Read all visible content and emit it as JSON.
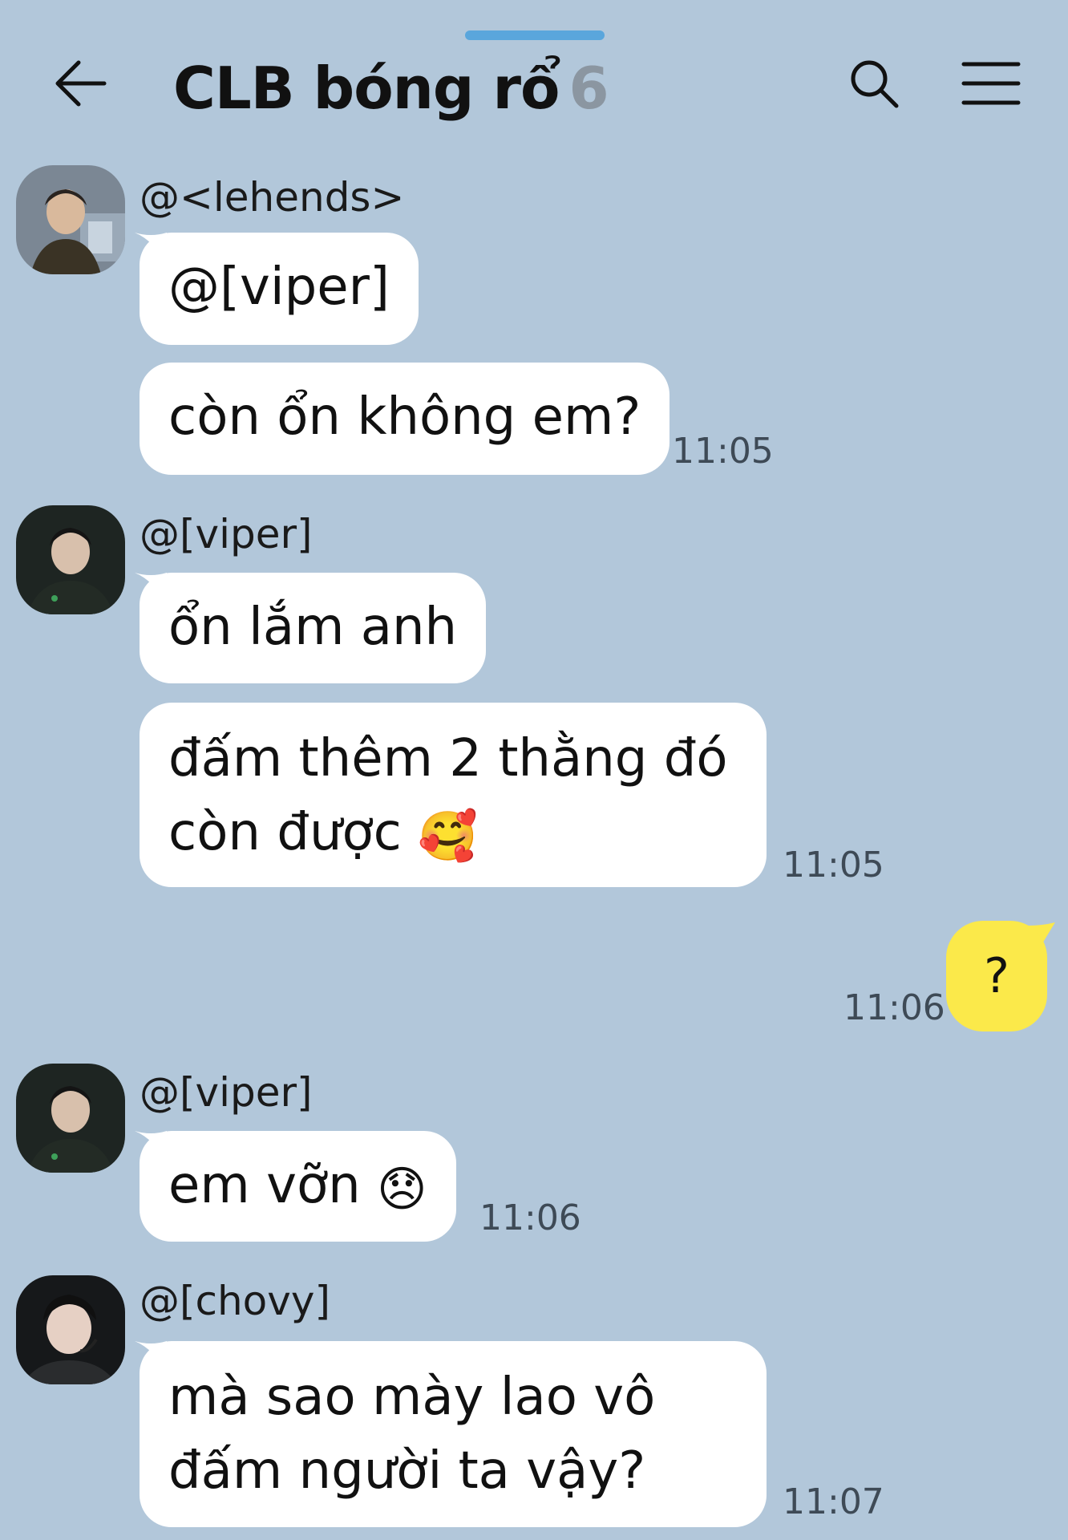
{
  "header": {
    "title": "CLB bóng rổ",
    "member_count": "6"
  },
  "icons": {
    "back": "arrow-left-icon",
    "search": "search-icon",
    "menu": "hamburger-menu-icon"
  },
  "colors": {
    "background": "#b2c7da",
    "bubble_other": "#ffffff",
    "bubble_me": "#fbe94a",
    "handle": "#5aa6dc"
  },
  "messages": [
    {
      "sender": "@<lehends>",
      "bubbles": [
        "@[viper]",
        "còn ổn không em?"
      ],
      "time": "11:05"
    },
    {
      "sender": "@[viper]",
      "bubbles": [
        "ổn lắm anh",
        "đấm thêm 2 thằng đó",
        "còn được"
      ],
      "emoji": "🥰",
      "time": "11:05"
    },
    {
      "sender": "me",
      "bubbles": [
        "?"
      ],
      "time": "11:06"
    },
    {
      "sender": "@[viper]",
      "bubbles": [
        "em vỡn"
      ],
      "emoji": "😞",
      "time": "11:06"
    },
    {
      "sender": "@[chovy]",
      "bubbles": [
        "mà sao mày lao vô",
        "đấm người ta vậy?"
      ],
      "time": "11:07"
    }
  ]
}
